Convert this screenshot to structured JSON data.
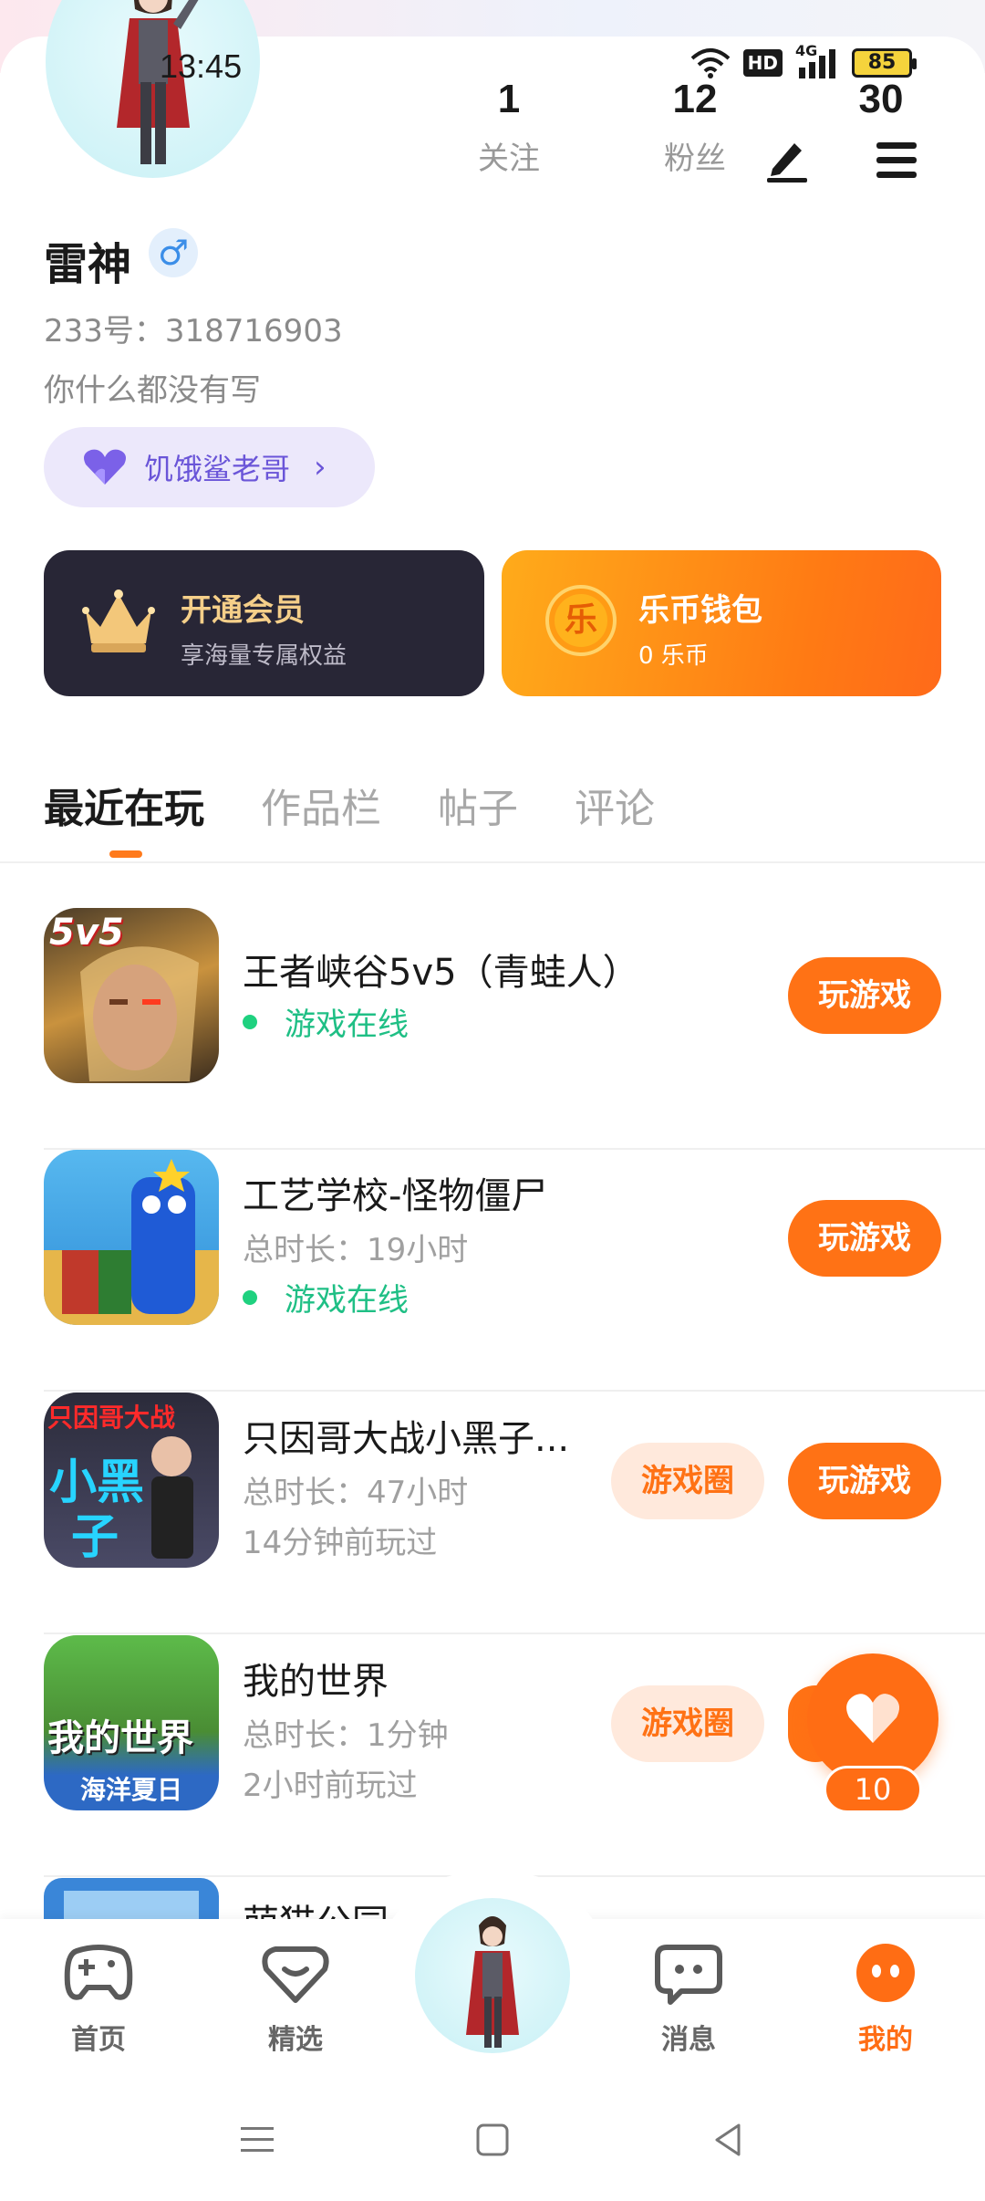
{
  "status_bar": {
    "time": "13:45",
    "network": "4G",
    "hd": "HD",
    "battery": "85"
  },
  "profile": {
    "stats": [
      {
        "num": "1",
        "label": "关注"
      },
      {
        "num": "12",
        "label": "粉丝"
      },
      {
        "num": "30",
        "label": ""
      }
    ],
    "name": "雷神",
    "gender_symbol": "♂",
    "uid": "233号：318716903",
    "bio": "你什么都没有写",
    "badge": "饥饿鲨老哥",
    "badge_chevron": "›"
  },
  "cards": {
    "vip_title": "开通会员",
    "vip_sub": "享海量专属权益",
    "wallet_title": "乐币钱包",
    "wallet_sub": "0 乐币",
    "coin_char": "乐"
  },
  "tabs": [
    "最近在玩",
    "作品栏",
    "帖子",
    "评论"
  ],
  "games": [
    {
      "name": "王者峡谷5v5（青蛙人）",
      "duration": "",
      "last_played": "",
      "online": "游戏在线",
      "circle": "",
      "play": "玩游戏"
    },
    {
      "name": "工艺学校-怪物僵尸",
      "duration": "总时长：19小时",
      "last_played": "",
      "online": "游戏在线",
      "circle": "",
      "play": "玩游戏"
    },
    {
      "name": "只因哥大战小黑子...",
      "duration": "总时长：47小时",
      "last_played": "14分钟前玩过",
      "online": "",
      "circle": "游戏圈",
      "play": "玩游戏"
    },
    {
      "name": "我的世界",
      "duration": "总时长：1分钟",
      "last_played": "2小时前玩过",
      "online": "",
      "circle": "游戏圈",
      "play": ""
    },
    {
      "name": "萌猫公园",
      "duration": "",
      "last_played": "",
      "online": "",
      "circle": "",
      "play": ""
    }
  ],
  "game_icon_text": {
    "g1": "5v5",
    "g3_top": "只因哥大战",
    "g3_mid": "小黑",
    "g3_bot": "子",
    "g4_main": "我的世界",
    "g4_sub": "海洋夏日"
  },
  "floating_like": {
    "count": "10"
  },
  "bottom_nav": [
    {
      "label": "首页",
      "icon": "gamepad-icon"
    },
    {
      "label": "精选",
      "icon": "heart-diamond-icon"
    },
    {
      "label": "消息",
      "icon": "chat-icon"
    },
    {
      "label": "我的",
      "icon": "face-icon"
    }
  ],
  "colors": {
    "accent": "#ff7215",
    "online": "#1fbf85",
    "badge_purple": "#6a55d8",
    "vip_gold": "#f5cf89"
  }
}
